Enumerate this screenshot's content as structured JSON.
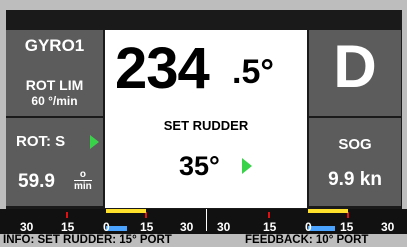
{
  "left_top": {
    "title": "GYRO1",
    "rot_lim_label": "ROT LIM",
    "rot_lim_value": "60 °/min"
  },
  "left_bottom": {
    "title": "ROT: S",
    "value": "59.9",
    "unit_top": "o",
    "unit_bottom": "min",
    "indicator_color": "#39d34a"
  },
  "center": {
    "heading_int": "234",
    "heading_frac": ".5°",
    "set_rudder_label": "SET RUDDER",
    "set_rudder_value": "35°"
  },
  "right_top": {
    "mode": "D"
  },
  "right_bottom": {
    "title": "SOG",
    "value": "9.9 kn"
  },
  "scale": {
    "left_labels": [
      "30",
      "15",
      "0",
      "15",
      "30"
    ],
    "right_labels": [
      "30",
      "15",
      "0",
      "15",
      "30"
    ],
    "tick_color": "#d11111",
    "yellow_color": "#ffe02a",
    "blue_color": "#4aa3ff"
  },
  "info": {
    "left": "INFO:  SET RUDDER: 15° PORT",
    "right": "FEEDBACK: 10° PORT"
  }
}
